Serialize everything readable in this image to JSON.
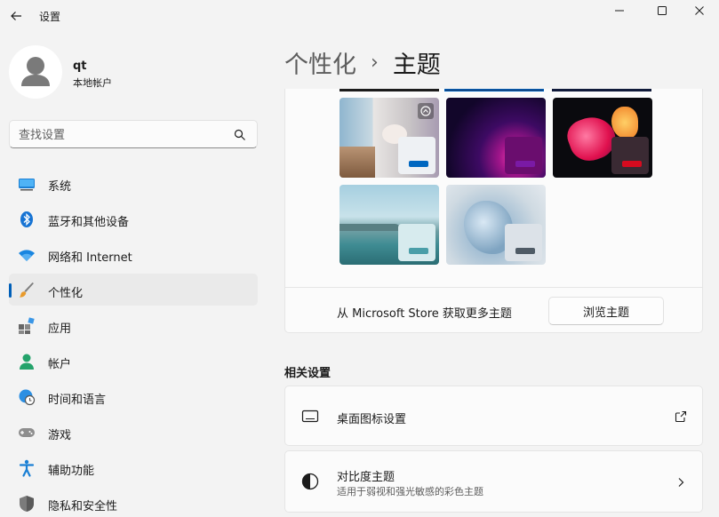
{
  "window": {
    "title": "设置"
  },
  "user": {
    "name": "qt",
    "account_type": "本地帐户"
  },
  "search": {
    "placeholder": "查找设置"
  },
  "nav": {
    "items": [
      {
        "label": "系统",
        "icon": "system-icon"
      },
      {
        "label": "蓝牙和其他设备",
        "icon": "bluetooth-icon"
      },
      {
        "label": "网络和 Internet",
        "icon": "wifi-icon"
      },
      {
        "label": "个性化",
        "icon": "brush-icon",
        "selected": true
      },
      {
        "label": "应用",
        "icon": "apps-icon"
      },
      {
        "label": "帐户",
        "icon": "account-icon"
      },
      {
        "label": "时间和语言",
        "icon": "globe-clock-icon"
      },
      {
        "label": "游戏",
        "icon": "gamepad-icon"
      },
      {
        "label": "辅助功能",
        "icon": "accessibility-icon"
      },
      {
        "label": "隐私和安全性",
        "icon": "shield-icon"
      }
    ]
  },
  "header": {
    "parent": "个性化",
    "separator": "›",
    "current": "主题"
  },
  "themes": {
    "store_text": "从 Microsoft Store 获取更多主题",
    "browse_label": "浏览主题"
  },
  "related": {
    "title": "相关设置",
    "desktop_icons_label": "桌面图标设置",
    "contrast_label": "对比度主题",
    "contrast_desc": "适用于弱视和强光敏感的彩色主题"
  },
  "colors": {
    "accent": "#005fb8",
    "background": "#f3f3f3",
    "card": "#fbfbfb"
  }
}
